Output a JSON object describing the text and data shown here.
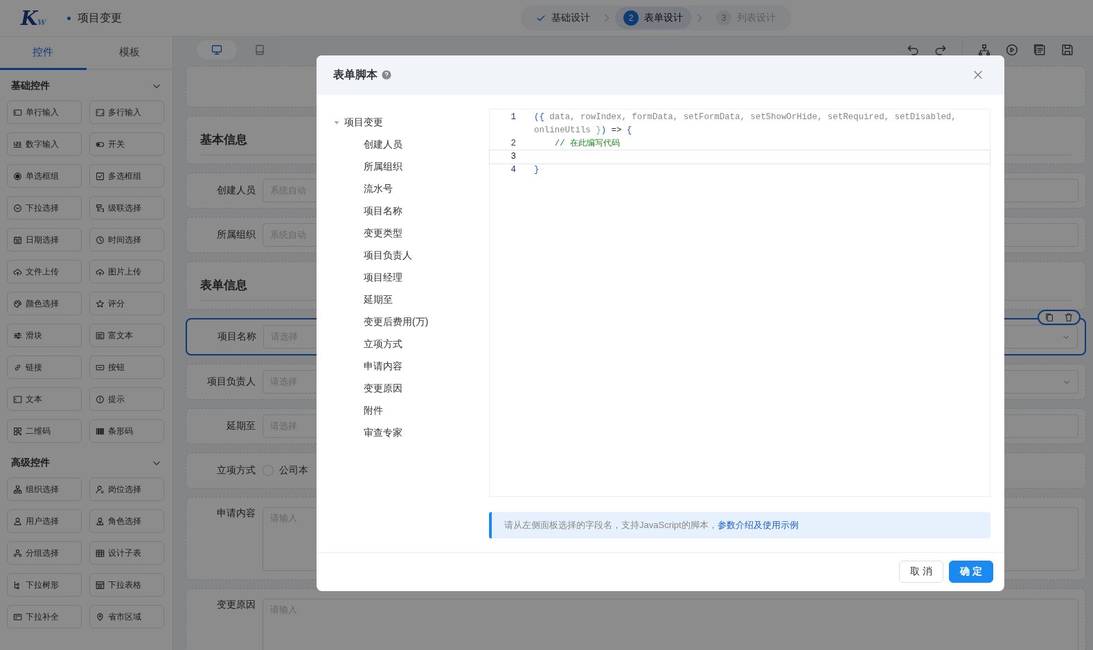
{
  "header": {
    "logo": {
      "main": "K",
      "sub": "W"
    },
    "title": "项目变更",
    "steps": [
      {
        "label": "基础设计",
        "completed": true,
        "selected": false
      },
      {
        "number": "2",
        "label": "表单设计",
        "completed": false,
        "selected": true
      },
      {
        "number": "3",
        "label": "列表设计",
        "completed": false,
        "selected": false
      }
    ]
  },
  "sidebar": {
    "tabs": [
      {
        "label": "控件",
        "selected": true
      },
      {
        "label": "模板",
        "selected": false
      }
    ],
    "sections": [
      {
        "title": "基础控件",
        "expanded": true,
        "items": [
          "单行输入",
          "多行输入",
          "数字输入",
          "开关",
          "单选框组",
          "多选框组",
          "下拉选择",
          "级联选择",
          "日期选择",
          "时间选择",
          "文件上传",
          "图片上传",
          "颜色选择",
          "评分",
          "滑块",
          "富文本",
          "链接",
          "按钮",
          "文本",
          "提示",
          "二维码",
          "条形码"
        ]
      },
      {
        "title": "高级控件",
        "expanded": true,
        "items": [
          "组织选择",
          "岗位选择",
          "用户选择",
          "角色选择",
          "分组选择",
          "设计子表",
          "下拉树形",
          "下拉表格",
          "下拉补全",
          "省市区域"
        ]
      }
    ]
  },
  "toolbar": {
    "devices": [
      {
        "kind": "desktop",
        "selected": true
      },
      {
        "kind": "tablet",
        "selected": false
      }
    ]
  },
  "form": {
    "rows": [
      {
        "kind": "empty"
      },
      {
        "kind": "section",
        "title": "基本信息"
      },
      {
        "kind": "input",
        "label": "创建人员",
        "placeholder": "系统自动"
      },
      {
        "kind": "input",
        "label": "所属组织",
        "placeholder": "系统自动"
      },
      {
        "kind": "section",
        "title": "表单信息"
      },
      {
        "kind": "select",
        "label": "项目名称",
        "placeholder": "请选择",
        "selected": true
      },
      {
        "kind": "select",
        "label": "项目负责人",
        "placeholder": "请选择",
        "selected": false
      },
      {
        "kind": "input",
        "label": "延期至",
        "placeholder": "请选择"
      },
      {
        "kind": "radio",
        "label": "立项方式",
        "option": "公司本",
        "checked": false
      },
      {
        "kind": "textarea",
        "label": "申请内容",
        "placeholder": "请输入"
      },
      {
        "kind": "textarea",
        "label": "变更原因",
        "placeholder": "请输入"
      }
    ]
  },
  "dialog": {
    "title": "表单脚本",
    "tree": {
      "label": "项目变更",
      "expanded": true,
      "children": [
        "创建人员",
        "所属组织",
        "流水号",
        "项目名称",
        "变更类型",
        "项目负责人",
        "项目经理",
        "延期至",
        "变更后费用(万)",
        "立项方式",
        "申请内容",
        "变更原因",
        "附件",
        "审查专家"
      ]
    },
    "code": [
      {
        "number": "1",
        "current": false,
        "tokens": [
          {
            "kind": "punct",
            "text": "({"
          },
          {
            "kind": "param",
            "text": " data, rowIndex, formData, setFormData, setShowOrHide, setRequired, setDisabled, onlineUtils "
          },
          {
            "kind": "brace",
            "text": "}"
          },
          {
            "kind": "punct",
            "text": ")"
          },
          {
            "kind": "op",
            "text": " => "
          },
          {
            "kind": "punct",
            "text": "{"
          }
        ]
      },
      {
        "number": "2",
        "current": false,
        "tokens": [
          {
            "kind": "comment",
            "text": "    // 在此编写代码"
          }
        ]
      },
      {
        "number": "3",
        "current": true
      },
      {
        "number": "4",
        "current": false,
        "tokens": [
          {
            "kind": "punct",
            "text": "}"
          }
        ]
      }
    ],
    "hint": {
      "text": "请从左侧面板选择的字段名，支持JavaScript的脚本，",
      "link": "参数介绍及使用示例"
    },
    "buttons": [
      {
        "kind": "default",
        "label": "取 消"
      },
      {
        "kind": "primary",
        "label": "确 定"
      }
    ]
  }
}
